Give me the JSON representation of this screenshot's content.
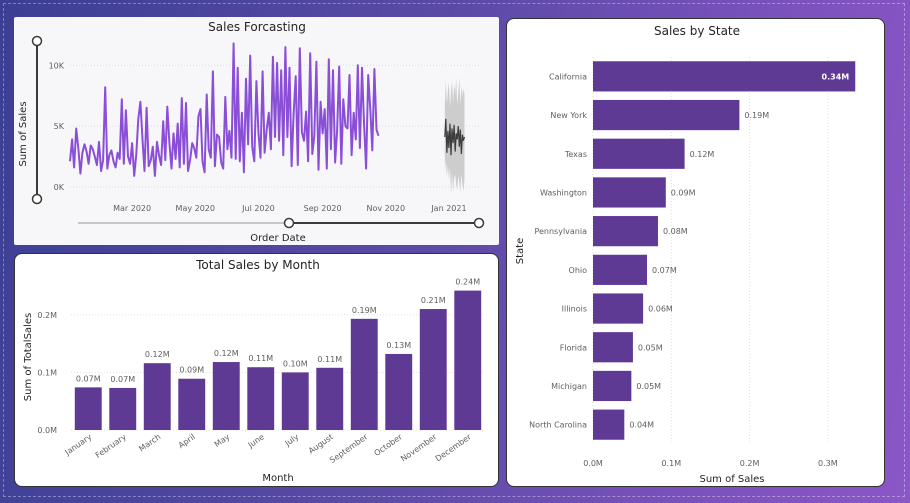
{
  "colors": {
    "bar": "#5f3a94",
    "line": "#8a4fd6",
    "forecast_band": "#c8c8c8",
    "forecast_line": "#3c3c3c"
  },
  "chart_data": [
    {
      "id": "forecast",
      "type": "line",
      "title": "Sales Forcasting",
      "xlabel": "Order Date",
      "ylabel": "Sum of Sales",
      "y_ticks": [
        "0K",
        "5K",
        "10K"
      ],
      "ylim": [
        -1000,
        12000
      ],
      "x_tick_labels": [
        "Mar 2020",
        "May 2020",
        "Jul 2020",
        "Sep 2020",
        "Nov 2020",
        "Jan 2021"
      ],
      "x_range": [
        "2020-01-01",
        "2021-01-31"
      ],
      "series": [
        {
          "start_date": "2020-01-01",
          "step_days": 2,
          "values": [
            2100,
            3900,
            1600,
            4800,
            3200,
            1100,
            2800,
            3500,
            2900,
            1900,
            3400,
            3100,
            2500,
            1800,
            3700,
            1300,
            2200,
            8200,
            1500,
            2600,
            3000,
            2100,
            1600,
            2800,
            2300,
            7200,
            1900,
            6300,
            2500,
            1900,
            3600,
            900,
            2700,
            5600,
            7000,
            3900,
            1300,
            6500,
            1700,
            2200,
            3300,
            900,
            3700,
            2600,
            1800,
            5400,
            2200,
            6600,
            3600,
            1500,
            4400,
            2300,
            5200,
            1600,
            7300,
            1900,
            6900,
            1300,
            2200,
            3600,
            3200,
            2400,
            5800,
            6400,
            2100,
            1200,
            7600,
            3100,
            2400,
            9500,
            1700,
            4300,
            4100,
            2000,
            1500,
            7400,
            3100,
            4600,
            2400,
            11800,
            2300,
            9800,
            2100,
            6100,
            1200,
            8900,
            3500,
            10800,
            3300,
            2100,
            8700,
            4500,
            2400,
            9500,
            2800,
            4700,
            6100,
            3100,
            10700,
            4100,
            10200,
            3800,
            9600,
            2600,
            11500,
            4100,
            9800,
            1700,
            6000,
            9100,
            1800,
            11400,
            4500,
            3800,
            6200,
            2100,
            11000,
            2700,
            4200,
            10300,
            1400,
            7000,
            4400,
            6400,
            1500,
            10500,
            3100,
            9600,
            2000,
            4600,
            9900,
            1900,
            7200,
            5000,
            4800,
            9200,
            2600,
            6100,
            3900,
            10000,
            3200,
            9800,
            5300,
            1500,
            9200,
            6400,
            3000,
            9700,
            4700,
            4200
          ]
        }
      ],
      "forecast": {
        "start_date": "2020-12-28",
        "step_days": 1,
        "values": [
          4100,
          5600,
          2800,
          4600,
          3200,
          5200,
          2600,
          4800,
          3600,
          5100,
          2900,
          4400,
          3900,
          5000,
          3300,
          4700,
          2700,
          4300,
          3800,
          4100
        ],
        "upper_values": [
          6600,
          8800,
          6800,
          7900,
          8600,
          6500,
          7800,
          8700,
          6900,
          8400,
          7600,
          8900,
          6800,
          7700,
          9000,
          6700,
          8300,
          7400,
          8100,
          7600
        ],
        "lower_values": [
          1400,
          2200,
          800,
          1800,
          600,
          1600,
          -600,
          1200,
          -400,
          700,
          1000,
          200,
          -300,
          900,
          400,
          -500,
          1100,
          200,
          -400,
          600
        ]
      }
    },
    {
      "id": "monthly",
      "type": "bar",
      "title": "Total Sales by Month",
      "xlabel": "Month",
      "ylabel": "Sum of TotalSales",
      "y_ticks": [
        "0.0M",
        "0.1M",
        "0.2M"
      ],
      "ylim": [
        0,
        0.25
      ],
      "categories": [
        "January",
        "February",
        "March",
        "April",
        "May",
        "June",
        "July",
        "August",
        "September",
        "October",
        "November",
        "December"
      ],
      "values": [
        0.074,
        0.073,
        0.116,
        0.089,
        0.118,
        0.109,
        0.1,
        0.108,
        0.193,
        0.132,
        0.21,
        0.242
      ],
      "labels": [
        "0.07M",
        "0.07M",
        "0.12M",
        "0.09M",
        "0.12M",
        "0.11M",
        "0.10M",
        "0.11M",
        "0.19M",
        "0.13M",
        "0.21M",
        "0.24M"
      ]
    },
    {
      "id": "state",
      "type": "bar",
      "orientation": "horizontal",
      "title": "Sales by State",
      "xlabel": "Sum of Sales",
      "ylabel": "State",
      "x_ticks": [
        "0.0M",
        "0.1M",
        "0.2M",
        "0.3M"
      ],
      "xlim": [
        0,
        0.35
      ],
      "categories": [
        "California",
        "New York",
        "Texas",
        "Washington",
        "Pennsylvania",
        "Ohio",
        "Illinois",
        "Florida",
        "Michigan",
        "North Carolina"
      ],
      "values": [
        0.335,
        0.187,
        0.117,
        0.093,
        0.083,
        0.069,
        0.064,
        0.051,
        0.049,
        0.04
      ],
      "labels": [
        "0.34M",
        "0.19M",
        "0.12M",
        "0.09M",
        "0.08M",
        "0.07M",
        "0.06M",
        "0.05M",
        "0.05M",
        "0.04M"
      ]
    }
  ]
}
